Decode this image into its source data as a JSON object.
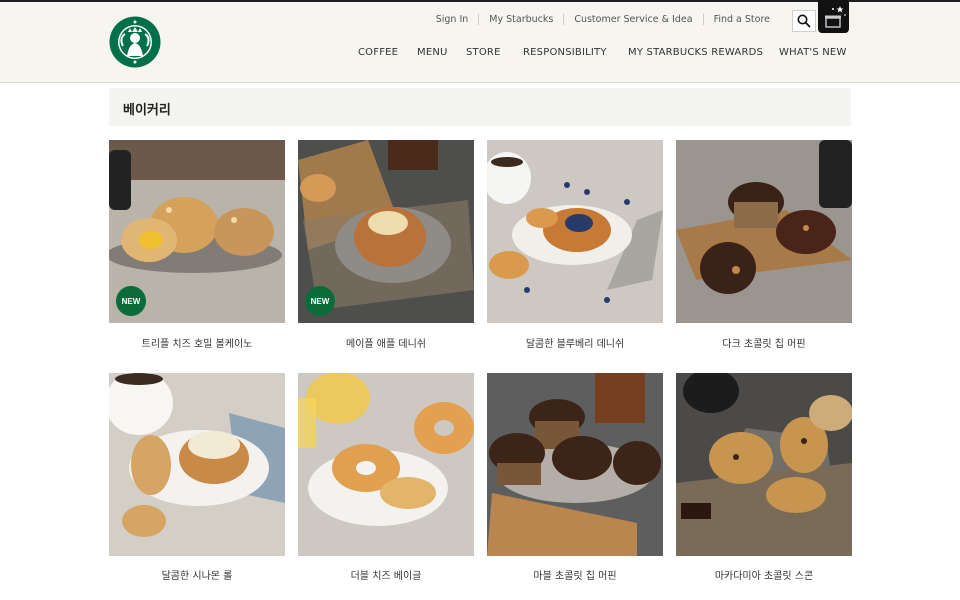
{
  "header": {
    "logo_text": "STARBUCKS",
    "util_links": [
      "Sign In",
      "My Starbucks",
      "Customer Service & Idea",
      "Find a Store"
    ],
    "nav": [
      "COFFEE",
      "MENU",
      "STORE",
      "RESPONSIBILITY",
      "MY STARBUCKS REWARDS",
      "WHAT'S NEW"
    ]
  },
  "page": {
    "title": "베이커리"
  },
  "badge_label": "NEW",
  "products": [
    {
      "name": "트리플 치즈 호밀 볼케이노",
      "is_new": true
    },
    {
      "name": "메이플 애플 데니쉬",
      "is_new": true
    },
    {
      "name": "달콤한 블루베리 데니쉬",
      "is_new": false
    },
    {
      "name": "다크 초콜릿 칩 머핀",
      "is_new": false
    },
    {
      "name": "달콤한 시나몬 롤",
      "is_new": false
    },
    {
      "name": "더블 치즈 베이글",
      "is_new": false
    },
    {
      "name": "마블 초콜릿 칩 머핀",
      "is_new": false
    },
    {
      "name": "마카다미아 초콜릿 스콘",
      "is_new": false
    }
  ],
  "colors": {
    "brand_green": "#0b6b3a",
    "header_bg": "#f6f5ef",
    "title_bar_bg": "#f4f4f1"
  }
}
